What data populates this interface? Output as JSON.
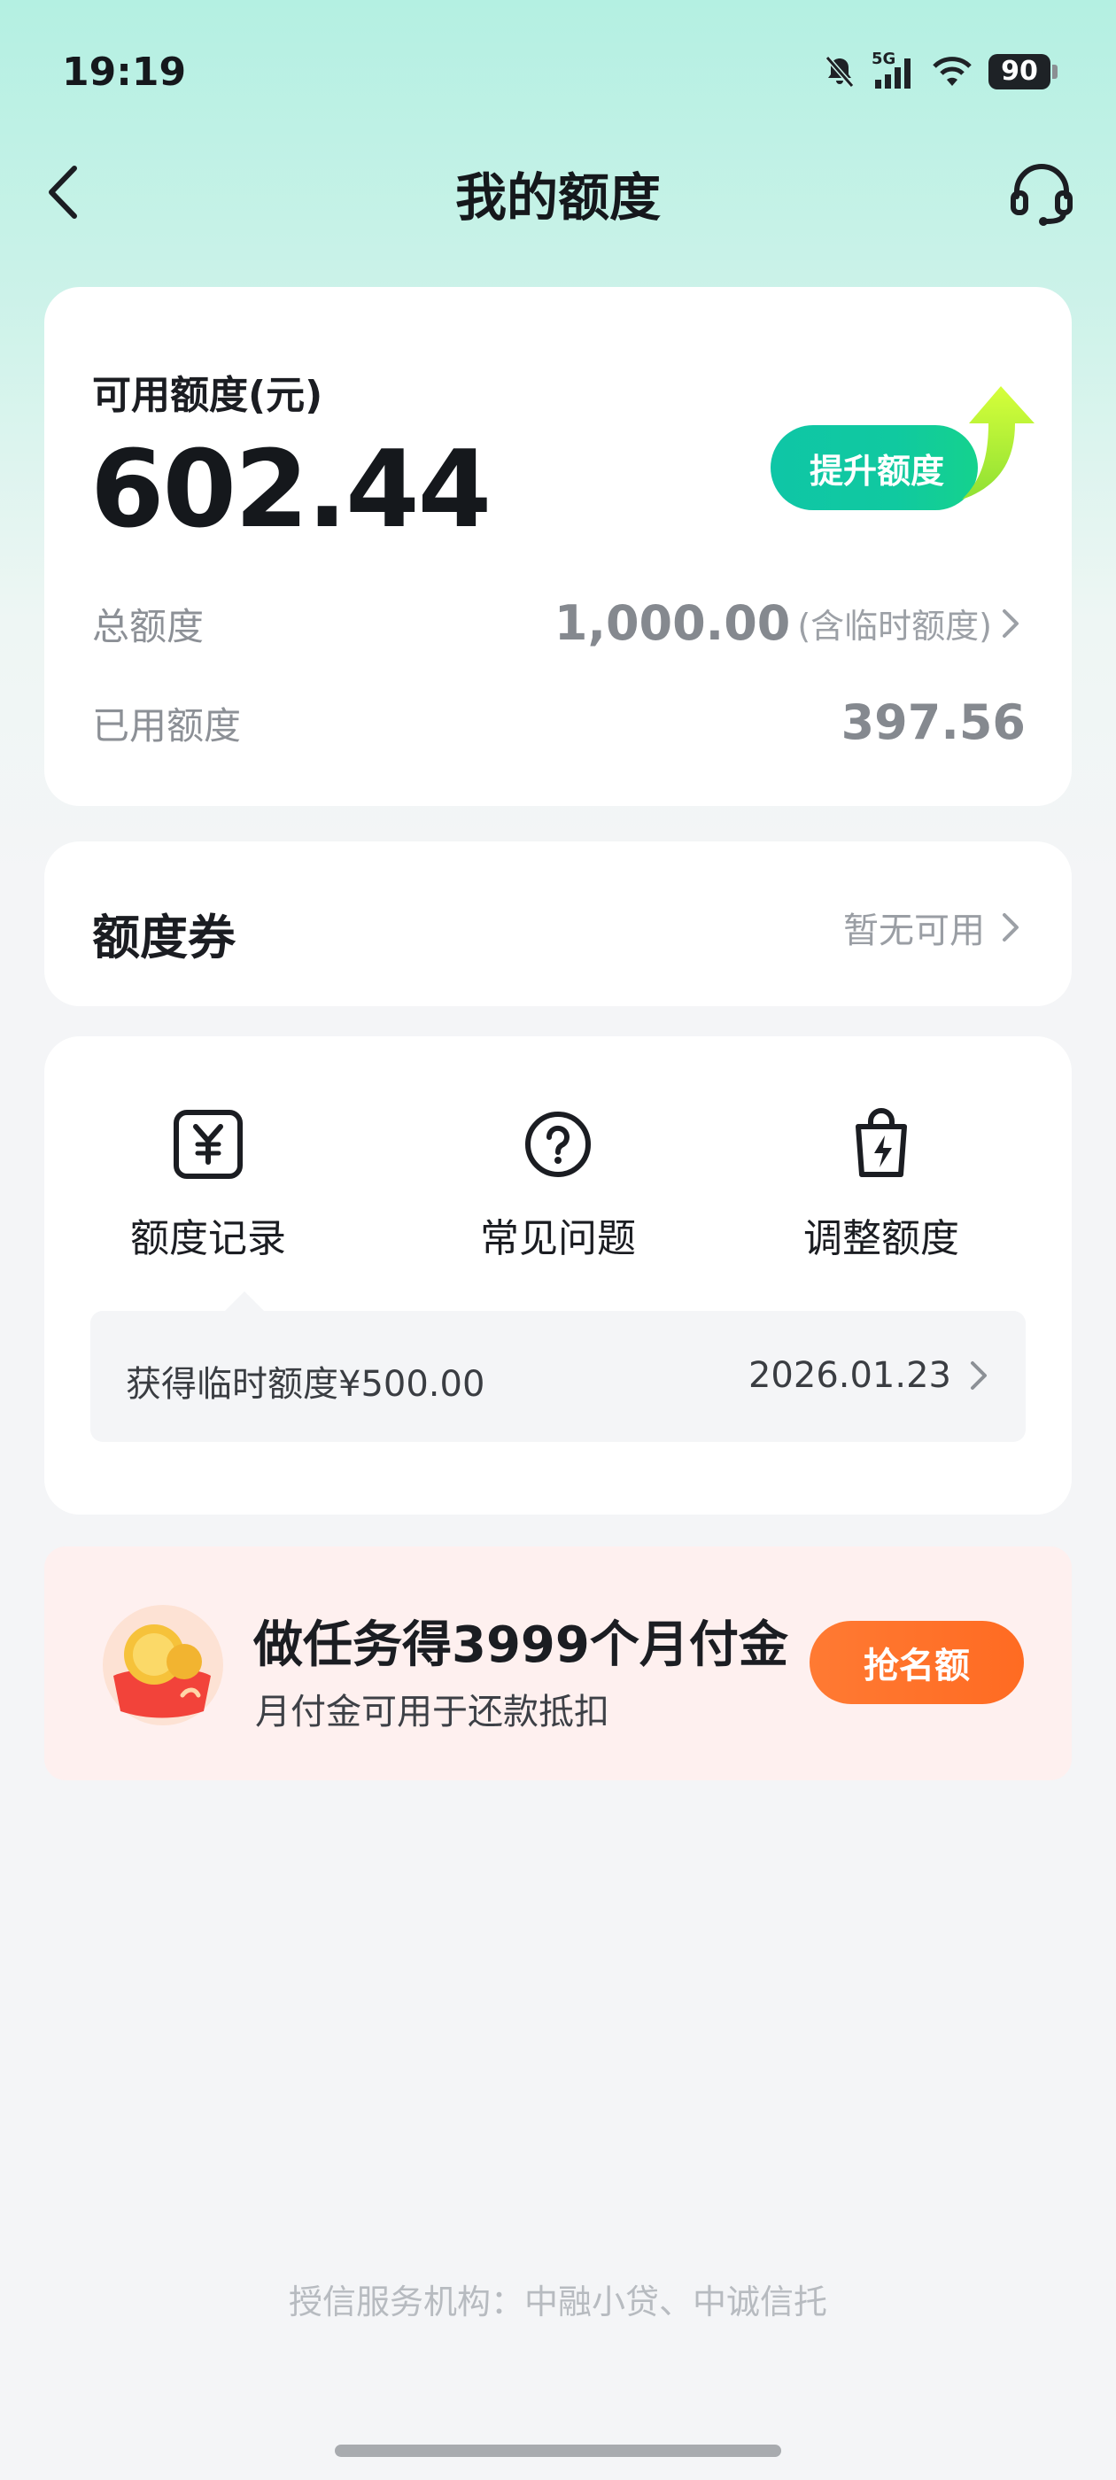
{
  "status_bar": {
    "time": "19:19",
    "network": "5G",
    "battery": "90"
  },
  "nav": {
    "title": "我的额度"
  },
  "quota": {
    "available_label": "可用额度(元)",
    "available_amount": "602.44",
    "raise_button": "提升额度",
    "total_label": "总额度",
    "total_value": "1,000.00",
    "total_note": "(含临时额度)",
    "used_label": "已用额度",
    "used_value": "397.56"
  },
  "coupon": {
    "title": "额度券",
    "status": "暂无可用"
  },
  "menu": {
    "items": [
      {
        "label": "额度记录",
        "icon": "yen-receipt-icon"
      },
      {
        "label": "常见问题",
        "icon": "question-circle-icon"
      },
      {
        "label": "调整额度",
        "icon": "bag-lightning-icon"
      }
    ],
    "record": {
      "text": "获得临时额度¥500.00",
      "date": "2026.01.23"
    }
  },
  "promo": {
    "title": "做任务得3999个月付金",
    "subtitle": "月付金可用于还款抵扣",
    "button": "抢名额"
  },
  "footer": {
    "text": "授信服务机构：中融小贷、中诚信托"
  },
  "colors": {
    "accent_green": "#10c9a0",
    "accent_orange": "#ff6b22",
    "promo_bg": "#fef0ef"
  }
}
